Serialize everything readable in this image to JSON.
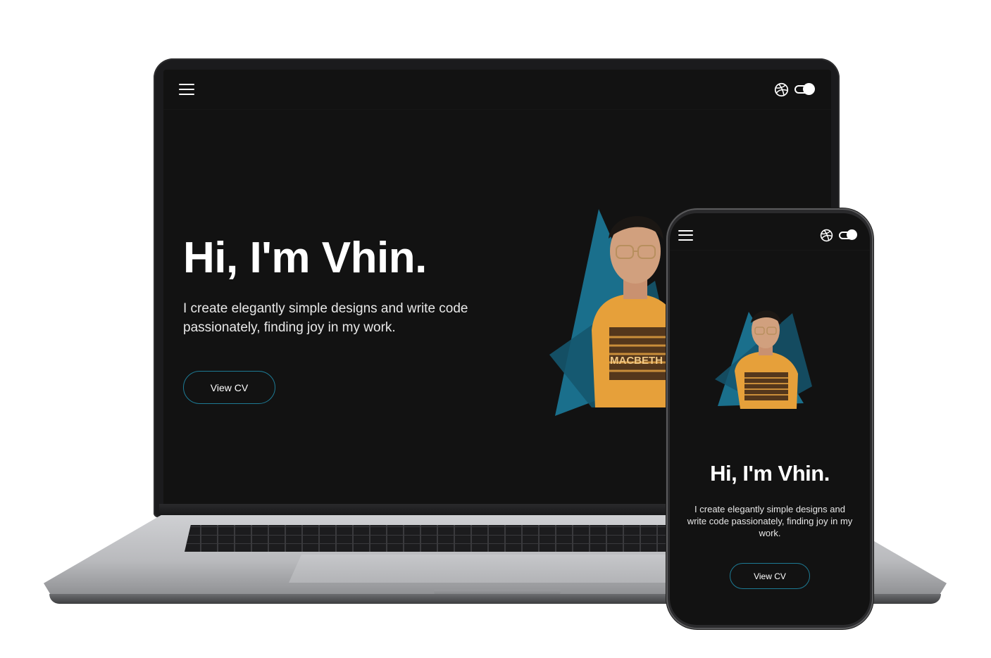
{
  "laptop": {
    "nav": {
      "menu_icon": "hamburger-icon",
      "dribbble_icon": "dribbble-icon",
      "theme_toggle": "toggle-switch"
    },
    "hero": {
      "title": "Hi, I'm Vhin.",
      "subtitle": "I create elegantly simple designs and write code passionately, finding joy in my work.",
      "cta_label": "View CV"
    }
  },
  "phone": {
    "nav": {
      "menu_icon": "hamburger-icon",
      "dribbble_icon": "dribbble-icon",
      "theme_toggle": "toggle-switch"
    },
    "hero": {
      "title": "Hi, I'm Vhin.",
      "subtitle": "I create elegantly simple designs and write code passionately, finding joy in my work.",
      "cta_label": "View CV"
    }
  },
  "portrait": {
    "shirt_text": "MACBETH"
  },
  "colors": {
    "background": "#121212",
    "accent": "#1a6f8c",
    "accent_dark": "#15566e",
    "text": "#ffffff",
    "button_border": "#1d7a94"
  }
}
